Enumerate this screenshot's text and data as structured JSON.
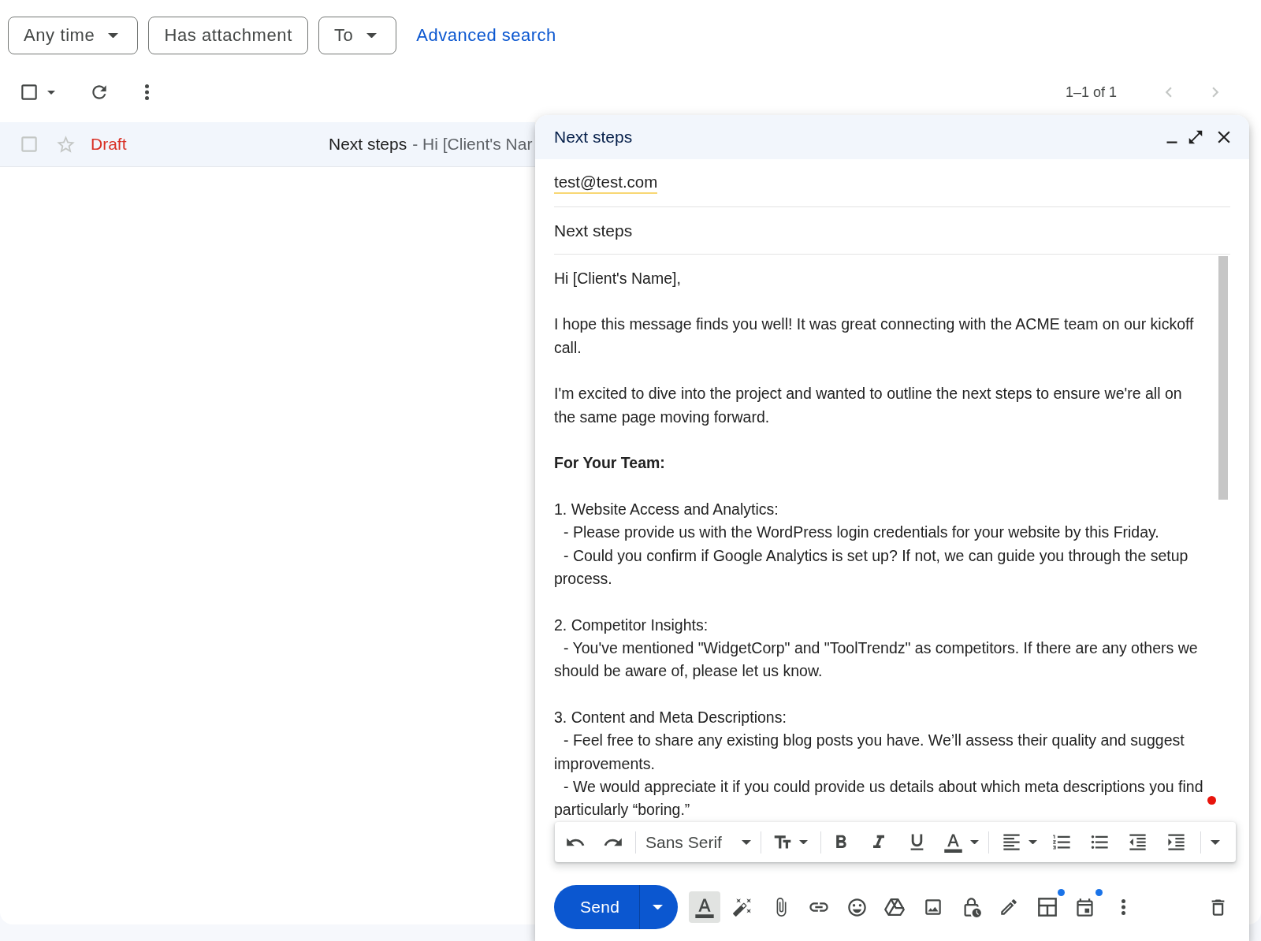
{
  "filters": {
    "chips": [
      {
        "label": "Any time",
        "dropdown": true
      },
      {
        "label": "Has attachment",
        "dropdown": false
      },
      {
        "label": "To",
        "dropdown": true
      }
    ],
    "advanced_link": "Advanced search"
  },
  "list_toolbar": {
    "select_all_checked": false,
    "pagination": "1–1 of 1",
    "prev_disabled": true,
    "next_disabled": true
  },
  "messages": [
    {
      "checked": false,
      "starred": false,
      "status": "Draft",
      "subject": "Next steps",
      "snippet": "- Hi [Client's Nar"
    }
  ],
  "compose": {
    "title": "Next steps",
    "to": "test@test.com",
    "subject": "Next steps",
    "body": [
      {
        "lines": [
          {
            "kind": "plain",
            "text": "Hi [Client's Name],"
          }
        ]
      },
      {
        "lines": [
          {
            "kind": "plain",
            "text": "I hope this message finds you well! It was great connecting with the ACME team on our kickoff call."
          }
        ]
      },
      {
        "lines": [
          {
            "kind": "plain",
            "text": "I'm excited to dive into the project and wanted to outline the next steps to ensure we're all on the same page moving forward."
          }
        ]
      },
      {
        "lines": [
          {
            "kind": "bold",
            "text": "For Your Team:"
          }
        ]
      },
      {
        "lines": [
          {
            "kind": "plain",
            "text": "1. Website Access and Analytics:"
          },
          {
            "kind": "indented",
            "text": "- Please provide us with the WordPress login credentials for your website by this Friday."
          },
          {
            "kind": "indented",
            "text": "- Could you confirm if Google Analytics is set up? If not, we can guide you through the setup process."
          }
        ]
      },
      {
        "lines": [
          {
            "kind": "plain",
            "text": "2. Competitor Insights:"
          },
          {
            "kind": "indented",
            "text": "- You've mentioned \"WidgetCorp\" and \"ToolTrendz\" as competitors. If there are any others we should be aware of, please let us know."
          }
        ]
      },
      {
        "lines": [
          {
            "kind": "plain",
            "text": "3. Content and Meta Descriptions:"
          },
          {
            "kind": "indented",
            "text": "- Feel free to share any existing blog posts you have. We’ll assess their quality and suggest improvements."
          },
          {
            "kind": "indented",
            "text": "- We would appreciate it if you could provide us details about which meta descriptions you find particularly “boring.”"
          }
        ]
      }
    ],
    "format_bar": {
      "font": "Sans Serif"
    },
    "send_label": "Send",
    "tools": [
      {
        "selected": true,
        "new_badge": false
      },
      {
        "selected": false,
        "new_badge": false
      },
      {
        "selected": false,
        "new_badge": false
      },
      {
        "selected": false,
        "new_badge": false
      },
      {
        "selected": false,
        "new_badge": false
      },
      {
        "selected": false,
        "new_badge": false
      },
      {
        "selected": false,
        "new_badge": false
      },
      {
        "selected": false,
        "new_badge": false
      },
      {
        "selected": false,
        "new_badge": false
      },
      {
        "selected": false,
        "new_badge": true
      },
      {
        "selected": false,
        "new_badge": true
      },
      {
        "selected": false,
        "new_badge": false
      }
    ]
  }
}
